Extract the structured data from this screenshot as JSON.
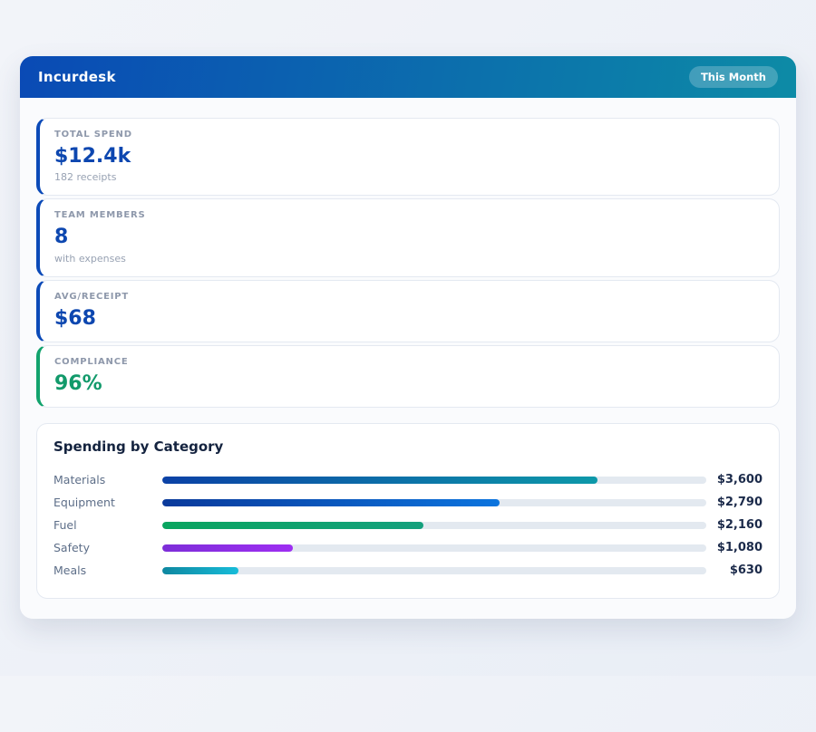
{
  "app": {
    "title": "Incurdesk",
    "period_badge": "This Month"
  },
  "stats": [
    {
      "label": "TOTAL SPEND",
      "value": "$12.4k",
      "sub": "182 receipts",
      "accent": "#0b4ab8",
      "value_color": "#0d47b0"
    },
    {
      "label": "TEAM MEMBERS",
      "value": "8",
      "sub": "with expenses",
      "accent": "#0b4ab8",
      "value_color": "#0d47b0"
    },
    {
      "label": "AVG/RECEIPT",
      "value": "$68",
      "sub": "",
      "accent": "#0b4ab8",
      "value_color": "#0d47b0"
    },
    {
      "label": "COMPLIANCE",
      "value": "96%",
      "sub": "",
      "accent": "#12a36d",
      "value_color": "#129a6b"
    }
  ],
  "chart_data": {
    "type": "bar",
    "orientation": "horizontal",
    "title": "Spending by Category",
    "categories": [
      "Materials",
      "Equipment",
      "Fuel",
      "Safety",
      "Meals"
    ],
    "values": [
      3600,
      2790,
      2160,
      1080,
      630
    ],
    "value_labels": [
      "$3,600",
      "$2,790",
      "$2,160",
      "$1,080",
      "$630"
    ],
    "axis_max": 4500,
    "grid": false,
    "legend": false,
    "bar_gradients": [
      [
        "#0b41a6",
        "#0d99a9"
      ],
      [
        "#0a3a9b",
        "#0b74de"
      ],
      [
        "#09a55f",
        "#14a07d"
      ],
      [
        "#7d2ed8",
        "#9e2ef2"
      ],
      [
        "#0e87a0",
        "#17bcd9"
      ]
    ],
    "track_color": "#e3e9f0"
  },
  "colors": {
    "header_gradient_start": "#0a4ab5",
    "header_gradient_end": "#0d8ba6",
    "badge_bg": "rgba(255,255,255,0.22)",
    "body_bg": "#fafbfd",
    "card_border": "#e4e9f1",
    "accent_blue": "#0b4ab8",
    "accent_green": "#12a36d"
  }
}
